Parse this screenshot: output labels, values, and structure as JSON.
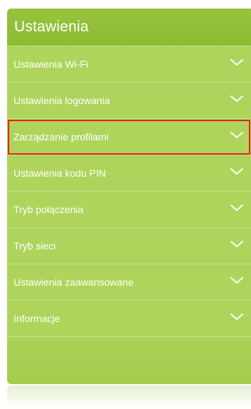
{
  "panel": {
    "title": "Ustawienia",
    "selected_index": 2,
    "items": [
      {
        "label": "Ustawienia Wi-Fi",
        "name": "ustawienia-wifi"
      },
      {
        "label": "Ustawienia logowania",
        "name": "ustawienia-logowania"
      },
      {
        "label": "Zarządzanie profilami",
        "name": "zarzadzanie-profilami"
      },
      {
        "label": "Ustawienia kodu PIN",
        "name": "ustawienia-kodu-pin"
      },
      {
        "label": "Tryb połączenia",
        "name": "tryb-polaczenia"
      },
      {
        "label": "Tryb sieci",
        "name": "tryb-sieci"
      },
      {
        "label": "Ustawienia zaawansowane",
        "name": "ustawienia-zaawansowane"
      },
      {
        "label": "Informacje",
        "name": "informacje"
      }
    ]
  },
  "icons": {
    "expand": "chevron-down-icon"
  },
  "colors": {
    "panel_bg": "#aed45c",
    "header_bg": "#8cbc34",
    "text": "#ffffff",
    "selection_outline": "#e8231f"
  }
}
